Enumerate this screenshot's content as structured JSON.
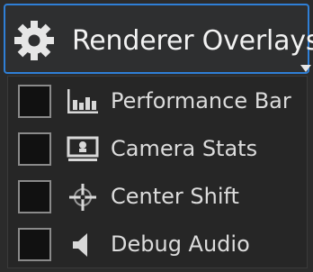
{
  "header": {
    "title": "Renderer Overlays",
    "icon": "gear-icon",
    "accent_color": "#2f7fd6"
  },
  "menu": {
    "items": [
      {
        "label": "Performance Bar",
        "icon": "bar-chart-icon",
        "checked": false
      },
      {
        "label": "Camera Stats",
        "icon": "monitor-icon",
        "checked": false
      },
      {
        "label": "Center Shift",
        "icon": "crosshair-icon",
        "checked": false
      },
      {
        "label": "Debug Audio",
        "icon": "speaker-icon",
        "checked": false
      }
    ]
  }
}
